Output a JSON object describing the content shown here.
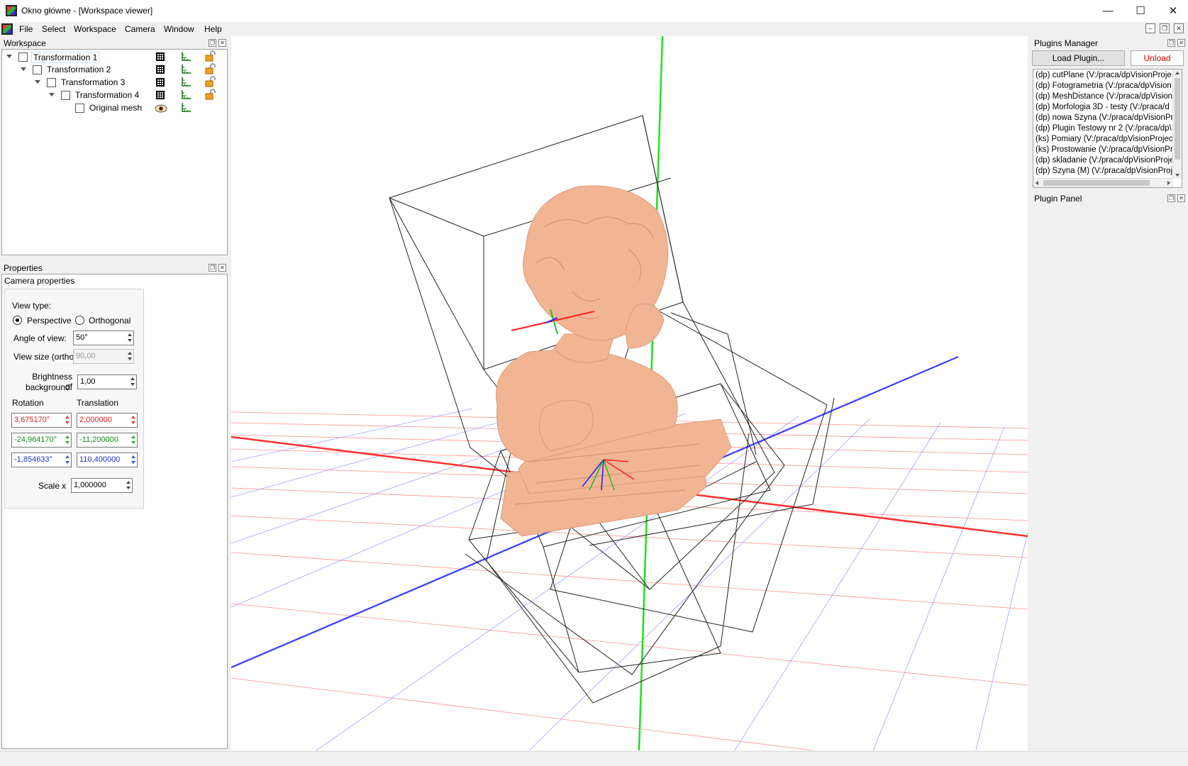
{
  "window": {
    "title": "Okno główne - [Workspace viewer]",
    "minimize": "—",
    "maximize": "☐",
    "close": "✕"
  },
  "menu": {
    "items": [
      "File",
      "Select",
      "Workspace",
      "Camera",
      "Window",
      "Help"
    ]
  },
  "workspace": {
    "title": "Workspace",
    "tree": [
      {
        "label": "Transformation 1",
        "selected": true
      },
      {
        "label": "Transformation 2"
      },
      {
        "label": "Transformation 3"
      },
      {
        "label": "Transformation 4"
      },
      {
        "label": "Original mesh"
      }
    ]
  },
  "properties": {
    "title": "Properties",
    "subtitle": "Camera properties",
    "view_type_label": "View type:",
    "perspective_label": "Perspective",
    "orthogonal_label": "Orthogonal",
    "perspective_selected": true,
    "angle_label": "Angle of view:",
    "angle_value": "50°",
    "view_size_label": "View size (ortho)",
    "view_size_value": "90,00",
    "brightness_label_1": "Brightness of",
    "brightness_label_2": "background:",
    "brightness_value": "1,00",
    "rotation_label": "Rotation",
    "translation_label": "Translation",
    "rotation": [
      "3,675170°",
      "-24,964170°",
      "-1,854633°"
    ],
    "translation": [
      "2,000000",
      "-11,200000",
      "110,400000"
    ],
    "scale_label": "Scale",
    "scale_x": "x",
    "scale_value": "1,000000"
  },
  "plugins": {
    "title": "Plugins Manager",
    "load_label": "Load Plugin...",
    "unload_label": "Unload",
    "unload_color": "#e00000",
    "items": [
      "(dp) cutPlane (V:/praca/dpVisionProje",
      "(dp) Fotogrametria (V:/praca/dpVision",
      "(dp) MeshDistance (V:/praca/dpVision",
      "(dp) Morfologia 3D - testy (V:/praca/d",
      "(dp) nowa Szyna (V:/praca/dpVisionPr",
      "(dp) Plugin Testowy nr 2 (V:/praca/dp\\",
      "(ks) Pomiary (V:/praca/dpVisionProjec",
      "(ks) Prostowanie (V:/praca/dpVisionPr",
      "(dp) skladanie (V:/praca/dpVisionProje",
      "(dp) Szyna (M) (V:/praca/dpVisionProj"
    ],
    "panel_title": "Plugin Panel"
  },
  "colors": {
    "axis_x": "#ff3030",
    "axis_y": "#20e020",
    "axis_z": "#3030ff",
    "mesh": "#f2b594"
  }
}
